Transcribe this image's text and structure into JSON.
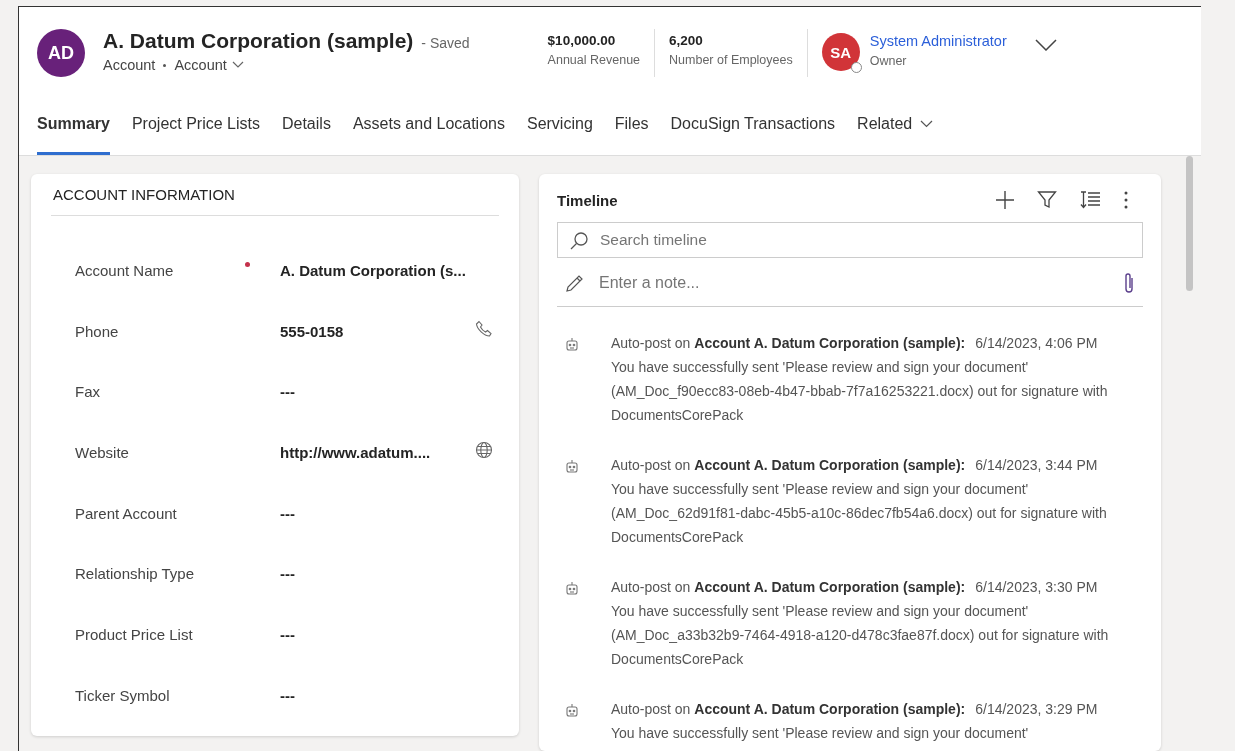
{
  "record": {
    "initials": "AD",
    "title": "A. Datum Corporation (sample)",
    "save_status": "- Saved",
    "entity": "Account",
    "form": "Account"
  },
  "header_fields": [
    {
      "value": "$10,000.00",
      "label": "Annual Revenue"
    },
    {
      "value": "6,200",
      "label": "Number of Employees"
    }
  ],
  "owner": {
    "initials": "SA",
    "name": "System Administrator",
    "label": "Owner"
  },
  "tabs": [
    {
      "label": "Summary",
      "selected": true,
      "dropdown": false
    },
    {
      "label": "Project Price Lists",
      "selected": false,
      "dropdown": false
    },
    {
      "label": "Details",
      "selected": false,
      "dropdown": false
    },
    {
      "label": "Assets and Locations",
      "selected": false,
      "dropdown": false
    },
    {
      "label": "Servicing",
      "selected": false,
      "dropdown": false
    },
    {
      "label": "Files",
      "selected": false,
      "dropdown": false
    },
    {
      "label": "DocuSign Transactions",
      "selected": false,
      "dropdown": false
    },
    {
      "label": "Related",
      "selected": false,
      "dropdown": true
    }
  ],
  "account_information": {
    "title": "ACCOUNT INFORMATION",
    "fields": [
      {
        "label": "Account Name",
        "value": "A. Datum Corporation (s...",
        "required": true,
        "kind": "text"
      },
      {
        "label": "Phone",
        "value": "555-0158",
        "required": false,
        "kind": "phone"
      },
      {
        "label": "Fax",
        "value": "---",
        "required": false,
        "kind": "text"
      },
      {
        "label": "Website",
        "value": "http://www.adatum....",
        "required": false,
        "kind": "url"
      },
      {
        "label": "Parent Account",
        "value": "---",
        "required": false,
        "kind": "text"
      },
      {
        "label": "Relationship Type",
        "value": "---",
        "required": false,
        "kind": "text"
      },
      {
        "label": "Product Price List",
        "value": "---",
        "required": false,
        "kind": "text"
      },
      {
        "label": "Ticker Symbol",
        "value": "---",
        "required": false,
        "kind": "text"
      }
    ]
  },
  "timeline": {
    "title": "Timeline",
    "search_placeholder": "Search timeline",
    "note_placeholder": "Enter a note...",
    "posts": [
      {
        "heading": "Auto-post on **Account A. Datum Corporation (sample):**",
        "time": "6/14/2023, 4:06 PM",
        "body": "You have successfully sent 'Please review and sign your document' (AM_Doc_f90ecc83-08eb-4b47-bbab-7f7a16253221.docx) out for signature with DocumentsCorePack"
      },
      {
        "heading": "Auto-post on **Account A. Datum Corporation (sample):**",
        "time": "6/14/2023, 3:44 PM",
        "body": "You have successfully sent 'Please review and sign your document' (AM_Doc_62d91f81-dabc-45b5-a10c-86dec7fb54a6.docx) out for signature with DocumentsCorePack"
      },
      {
        "heading": "Auto-post on **Account A. Datum Corporation (sample):**",
        "time": "6/14/2023, 3:30 PM",
        "body": "You have successfully sent 'Please review and sign your document' (AM_Doc_a33b32b9-7464-4918-a120-d478c3fae87f.docx) out for signature with DocumentsCorePack"
      },
      {
        "heading": "Auto-post on **Account A. Datum Corporation (sample):**",
        "time": "6/14/2023, 3:29 PM",
        "body": "You have successfully sent 'Please review and sign your document'"
      }
    ]
  }
}
